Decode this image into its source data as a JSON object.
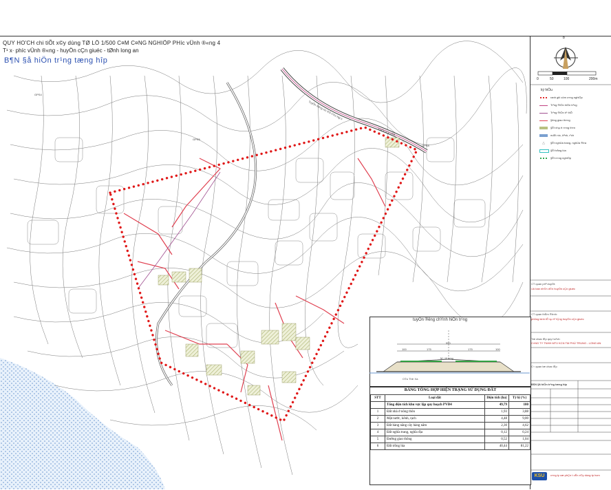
{
  "header": {
    "line1": "QUY HO'CH chi tiÕt x©y dùng TØ LÖ 1/500 C¤M C¤NG NGHIÖP PH­íc vÜnh ®«ng 4",
    "line2": "T¹ x· ph­íc vÜnh ®«ng - huyÖn cÇn giuéc - tØnh long an",
    "line3": "B¶N §å hiÖn tr¹ng tæng hîp"
  },
  "map": {
    "road_label_top": "TuyÕn ®­êng n­íc ®Ò C©u Ng¨n",
    "road_label_small": "ThiÕt cÇu chia",
    "gps_labels": [
      "GPS4",
      "GPS5",
      "GPS8"
    ],
    "boundary_color": "#e01818"
  },
  "sidebar": {
    "north_label": "b",
    "scale_ticks": [
      "0",
      "50",
      "100",
      "200m"
    ],
    "legend_title": "ký hiÖu",
    "legend": [
      {
        "label": "ranh giíi côm c«ng nghiÖp",
        "color": "#e01818",
        "kind": "dots"
      },
      {
        "label": "Tr¹ng ®iÖn hiÖn tr¹ng",
        "color": "#c04080",
        "kind": "line"
      },
      {
        "label": "Tr¹ng ®iÖn h¹ thÕ",
        "color": "#a05090",
        "kind": "line"
      },
      {
        "label": "§­êng giao th«ng",
        "color": "#e04050",
        "kind": "line"
      },
      {
        "label": "§Êt nhµ ë n«ng th«n",
        "color": "#b8c080",
        "kind": "fill"
      },
      {
        "label": "mÆt n­íc, kªnh, r¹ch",
        "color": "#7aa0d0",
        "kind": "fill"
      },
      {
        "label": "§Êt nghÜa trang, nghÜa ®Þa",
        "color": "#888888",
        "kind": "tri"
      },
      {
        "label": "§Êt trång lóa",
        "color": "#30c0c0",
        "kind": "rect"
      },
      {
        "label": "§Êt n«ng nghiÖp",
        "color": "#20a040",
        "kind": "dots"
      }
    ],
    "block1_title": "CT quan phª duyÖt:",
    "block1_body": "Uû ban nh©n d©n huyÖn cÇn giuéc",
    "block2_title": "CT quan thÈm ®Þnh:",
    "block2_body": "phßng kinh tÕ vµ h¹ tÇng huyÖn cÇn giuéc",
    "block3_title": "Tæ chøc lËp quy ho¹ch:",
    "block3_body": "C«NG TY TNHH MTV KCN TM PHÚ TRUNG - LONG AN",
    "block4_title": "C¬ quan tæ chøc lËp",
    "drawing_name": "B¶N §å hiÖn tr¹ng tæng hîp",
    "company_footer": "c«ng ty cæ phÇn t­ vÊn x©y dùng tp hcm",
    "logo_text": "KSU"
  },
  "section": {
    "title": "tuyÕn ®­êng chÝnh hiÖn tr¹ng",
    "width_total": "550",
    "widths": [
      "100",
      "175",
      "175",
      "100"
    ],
    "center_label": "M¸i tõ h­íng",
    "bottom_label": "C©u ThÞ Xa"
  },
  "table": {
    "title": "BẢNG TỔNG HỢP HIỆN TRẠNG SỬ DỤNG ĐẤT",
    "headers": [
      "STT",
      "Loại đất",
      "Diện tích (ha)",
      "Tỷ lệ (%)"
    ],
    "total_row": {
      "label": "Tổng diện tích khu vực lập quy hoạch PVĐ4",
      "area": "49,79",
      "pct": "100"
    },
    "rows": [
      {
        "stt": "1",
        "label": "Đất nhà ở nông thôn",
        "area": "1,93",
        "pct": "3,88"
      },
      {
        "stt": "2",
        "label": "Mặt nước, kênh, rạch",
        "area": "4,48",
        "pct": "9,00"
      },
      {
        "stt": "3",
        "label": "Đất hàng năng cây hàng năm",
        "area": "2,30",
        "pct": "4,62"
      },
      {
        "stt": "4",
        "label": "Đất nghĩa trang, nghĩa địa",
        "area": "0,12",
        "pct": "0,24"
      },
      {
        "stt": "5",
        "label": "Đường giao thông",
        "area": "0,52",
        "pct": "1,04"
      },
      {
        "stt": "6",
        "label": "Đất trồng lúa",
        "area": "40,44",
        "pct": "81,22"
      }
    ]
  }
}
